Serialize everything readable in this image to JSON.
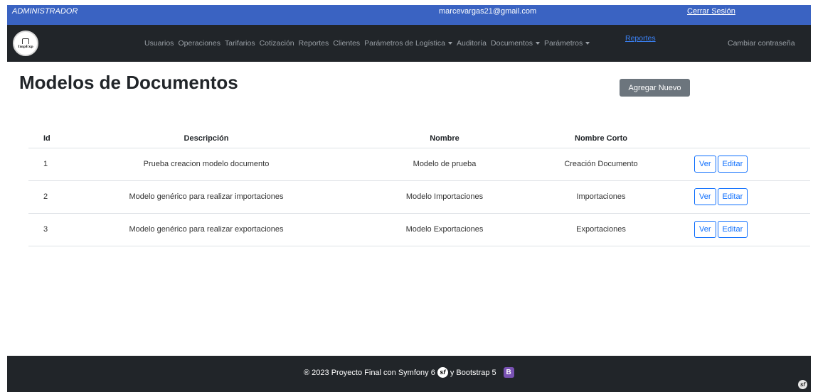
{
  "topbar": {
    "role": "ADMINISTRADOR",
    "email": "marcevargas21@gmail.com",
    "logout": "Cerrar Sesión"
  },
  "navbar": {
    "logo_text": "ImpExp",
    "items": [
      {
        "label": "Usuarios"
      },
      {
        "label": "Operaciones"
      },
      {
        "label": "Tarifarios"
      },
      {
        "label": "Cotización"
      },
      {
        "label": "Reportes"
      },
      {
        "label": "Clientes"
      },
      {
        "label": "Parámetros de Logística"
      },
      {
        "label": "Auditoría"
      },
      {
        "label": "Documentos"
      },
      {
        "label": "Parámetros"
      }
    ],
    "reports_link": "Reportes",
    "change_password": "Cambiar contraseña"
  },
  "main": {
    "title": "Modelos de Documentos",
    "add_button": "Agregar Nuevo",
    "table": {
      "headers": [
        "Id",
        "Descripción",
        "Nombre",
        "Nombre Corto"
      ],
      "rows": [
        {
          "id": "1",
          "descripcion": "Prueba creacion modelo documento",
          "nombre": "Modelo de prueba",
          "nombre_corto": "Creación Documento"
        },
        {
          "id": "2",
          "descripcion": "Modelo genérico para realizar importaciones",
          "nombre": "Modelo Importaciones",
          "nombre_corto": "Importaciones"
        },
        {
          "id": "3",
          "descripcion": "Modelo genérico para realizar exportaciones",
          "nombre": "Modelo Exportaciones",
          "nombre_corto": "Exportaciones"
        }
      ],
      "view_label": "Ver",
      "edit_label": "Editar"
    }
  },
  "footer": {
    "text_before": "® 2023 Proyecto Final con Symfony 6",
    "text_middle": "y Bootstrap 5",
    "symfony_icon": "sf",
    "bootstrap_icon": "B"
  },
  "colors": {
    "topbar": "#3a63c2",
    "navbar": "#212529",
    "primary": "#0d6efd",
    "secondary": "#6c757d"
  }
}
